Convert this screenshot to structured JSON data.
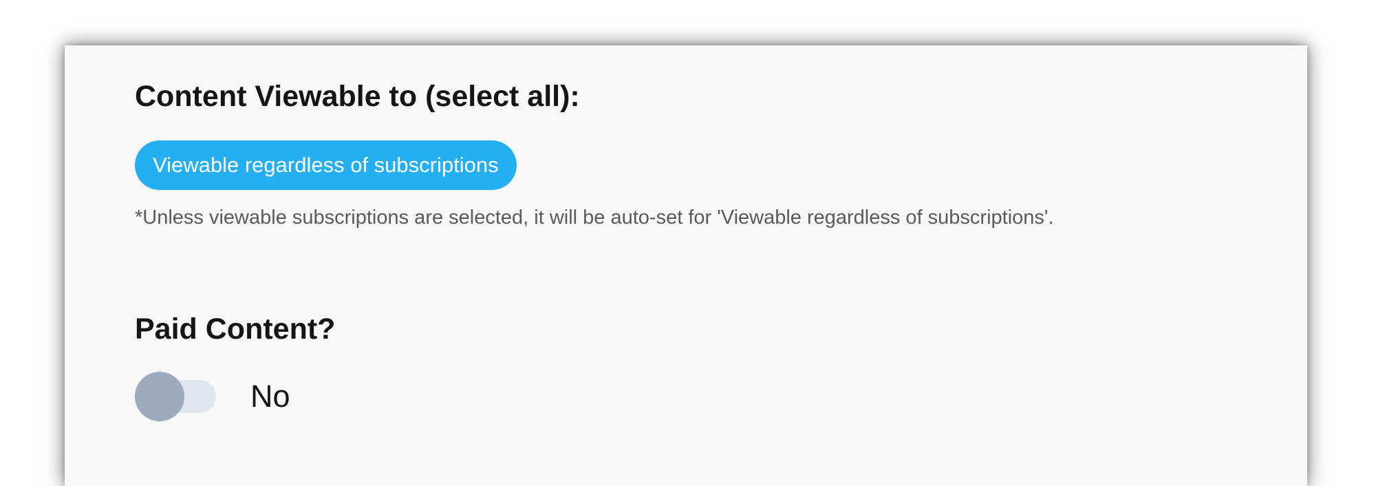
{
  "form": {
    "viewable_section": {
      "heading": "Content Viewable to (select all):",
      "chip_label": "Viewable regardless of subscriptions",
      "note": "*Unless viewable subscriptions are selected, it will be auto-set for 'Viewable regardless of subscriptions'."
    },
    "paid_section": {
      "heading": "Paid Content?",
      "toggle_state_label": "No"
    }
  },
  "colors": {
    "chip_background": "#25aff3",
    "toggle_knob": "#9eabbf",
    "toggle_track": "#e1e6ef",
    "card_background": "#f8f8f8"
  }
}
